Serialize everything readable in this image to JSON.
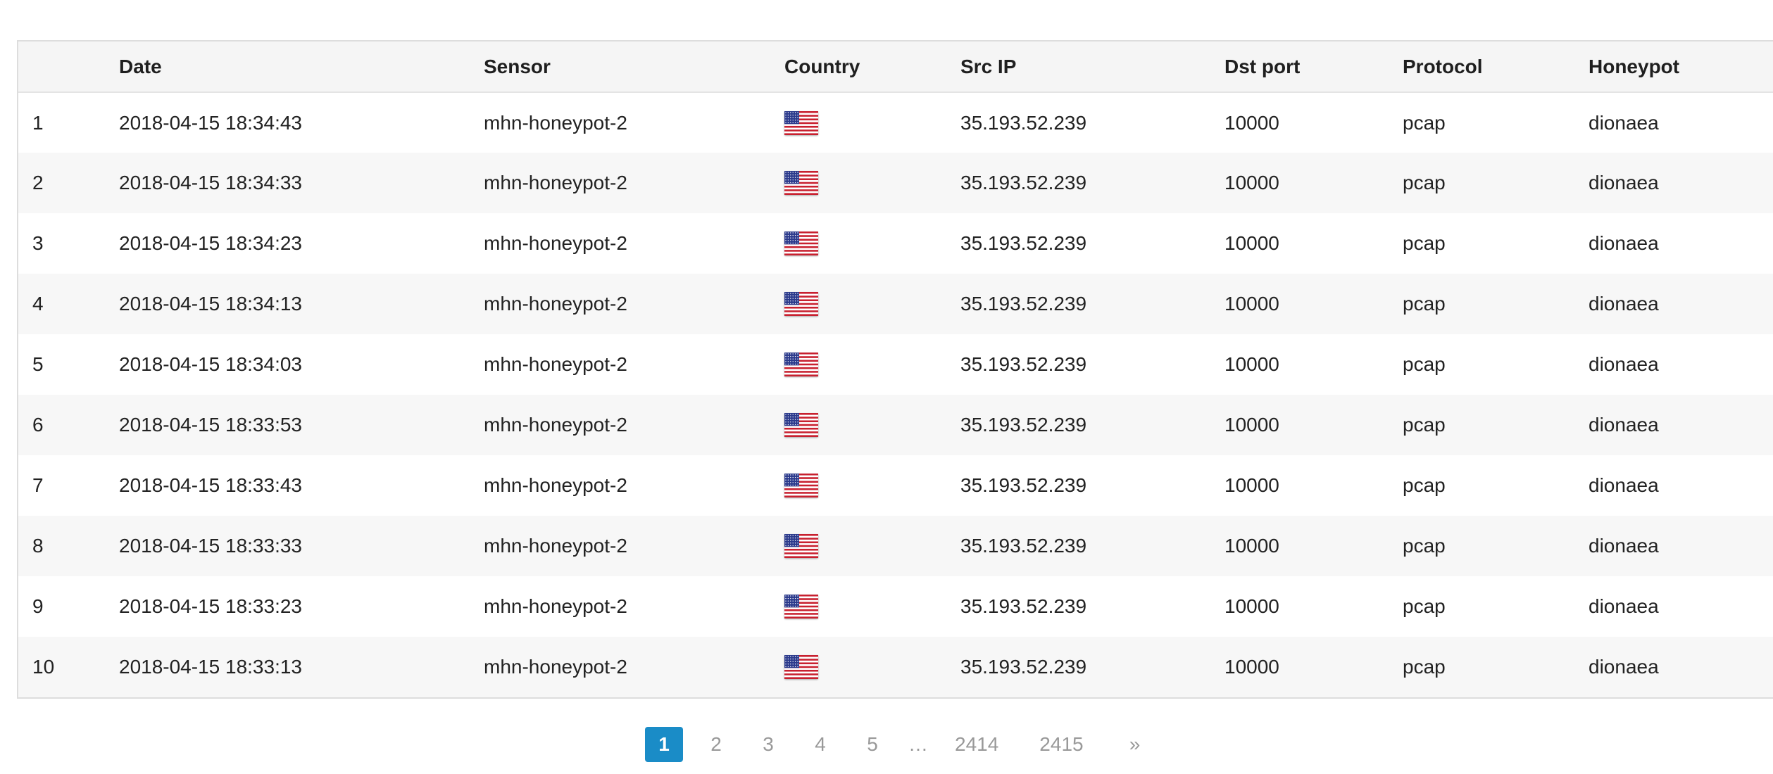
{
  "table": {
    "columns": [
      "",
      "Date",
      "Sensor",
      "Country",
      "Src IP",
      "Dst port",
      "Protocol",
      "Honeypot"
    ],
    "rows": [
      {
        "index": "1",
        "date": "2018-04-15 18:34:43",
        "sensor": "mhn-honeypot-2",
        "country_flag": "us-flag-icon",
        "src_ip": "35.193.52.239",
        "dst_port": "10000",
        "protocol": "pcap",
        "honeypot": "dionaea"
      },
      {
        "index": "2",
        "date": "2018-04-15 18:34:33",
        "sensor": "mhn-honeypot-2",
        "country_flag": "us-flag-icon",
        "src_ip": "35.193.52.239",
        "dst_port": "10000",
        "protocol": "pcap",
        "honeypot": "dionaea"
      },
      {
        "index": "3",
        "date": "2018-04-15 18:34:23",
        "sensor": "mhn-honeypot-2",
        "country_flag": "us-flag-icon",
        "src_ip": "35.193.52.239",
        "dst_port": "10000",
        "protocol": "pcap",
        "honeypot": "dionaea"
      },
      {
        "index": "4",
        "date": "2018-04-15 18:34:13",
        "sensor": "mhn-honeypot-2",
        "country_flag": "us-flag-icon",
        "src_ip": "35.193.52.239",
        "dst_port": "10000",
        "protocol": "pcap",
        "honeypot": "dionaea"
      },
      {
        "index": "5",
        "date": "2018-04-15 18:34:03",
        "sensor": "mhn-honeypot-2",
        "country_flag": "us-flag-icon",
        "src_ip": "35.193.52.239",
        "dst_port": "10000",
        "protocol": "pcap",
        "honeypot": "dionaea"
      },
      {
        "index": "6",
        "date": "2018-04-15 18:33:53",
        "sensor": "mhn-honeypot-2",
        "country_flag": "us-flag-icon",
        "src_ip": "35.193.52.239",
        "dst_port": "10000",
        "protocol": "pcap",
        "honeypot": "dionaea"
      },
      {
        "index": "7",
        "date": "2018-04-15 18:33:43",
        "sensor": "mhn-honeypot-2",
        "country_flag": "us-flag-icon",
        "src_ip": "35.193.52.239",
        "dst_port": "10000",
        "protocol": "pcap",
        "honeypot": "dionaea"
      },
      {
        "index": "8",
        "date": "2018-04-15 18:33:33",
        "sensor": "mhn-honeypot-2",
        "country_flag": "us-flag-icon",
        "src_ip": "35.193.52.239",
        "dst_port": "10000",
        "protocol": "pcap",
        "honeypot": "dionaea"
      },
      {
        "index": "9",
        "date": "2018-04-15 18:33:23",
        "sensor": "mhn-honeypot-2",
        "country_flag": "us-flag-icon",
        "src_ip": "35.193.52.239",
        "dst_port": "10000",
        "protocol": "pcap",
        "honeypot": "dionaea"
      },
      {
        "index": "10",
        "date": "2018-04-15 18:33:13",
        "sensor": "mhn-honeypot-2",
        "country_flag": "us-flag-icon",
        "src_ip": "35.193.52.239",
        "dst_port": "10000",
        "protocol": "pcap",
        "honeypot": "dionaea"
      }
    ]
  },
  "pagination": {
    "items": [
      {
        "label": "1",
        "active": true,
        "type": "page"
      },
      {
        "label": "2",
        "active": false,
        "type": "page"
      },
      {
        "label": "3",
        "active": false,
        "type": "page"
      },
      {
        "label": "4",
        "active": false,
        "type": "page"
      },
      {
        "label": "5",
        "active": false,
        "type": "page"
      },
      {
        "label": "…",
        "active": false,
        "type": "ellipsis"
      },
      {
        "label": "2414",
        "active": false,
        "type": "page"
      },
      {
        "label": "2415",
        "active": false,
        "type": "page"
      },
      {
        "label": "»",
        "active": false,
        "type": "next"
      }
    ]
  },
  "colors": {
    "header_bg": "#f5f5f5",
    "stripe_bg": "#f7f7f7",
    "active_page": "#1a8cc7",
    "muted_text": "#999999"
  }
}
